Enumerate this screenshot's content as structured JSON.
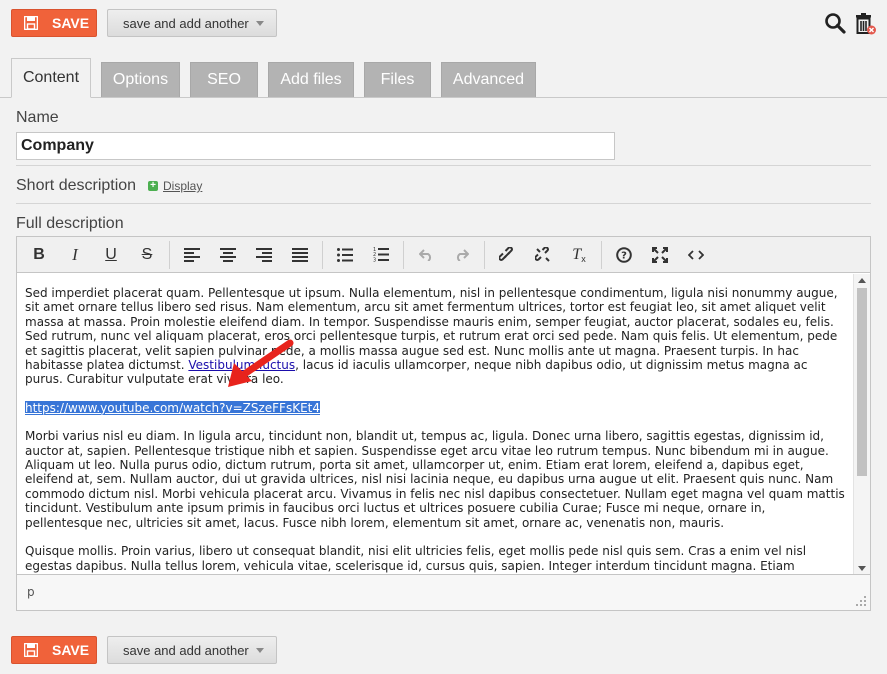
{
  "top_actions": {
    "save_label": "SAVE",
    "save_another_label": "save and add another"
  },
  "tabs": [
    {
      "label": "Content",
      "active": true
    },
    {
      "label": "Options",
      "active": false
    },
    {
      "label": "SEO",
      "active": false
    },
    {
      "label": "Add files",
      "active": false
    },
    {
      "label": "Files",
      "active": false
    },
    {
      "label": "Advanced",
      "active": false
    }
  ],
  "fields": {
    "name_label": "Name",
    "name_value": "Company",
    "short_description_label": "Short description",
    "display_link": "Display",
    "full_description_label": "Full description"
  },
  "toolbar_icons": [
    "bold-icon",
    "italic-icon",
    "underline-icon",
    "strikethrough-icon",
    "align-left-icon",
    "align-center-icon",
    "align-right-icon",
    "align-justify-icon",
    "bullet-list-icon",
    "numbered-list-icon",
    "undo-icon",
    "redo-icon",
    "link-icon",
    "unlink-icon",
    "clear-format-icon",
    "help-icon",
    "fullscreen-icon",
    "source-code-icon"
  ],
  "editor": {
    "para1": "Sed imperdiet placerat quam. Pellentesque ut ipsum. Nulla elementum, nisl in pellentesque condimentum, ligula nisi nonummy augue, sit amet ornare tellus libero sed risus. Nam elementum, arcu sit amet fermentum ultrices, tortor est feugiat leo, sit amet aliquet velit massa at massa. Proin molestie eleifend diam. In tempor. Suspendisse mauris enim, semper feugiat, auctor placerat, sodales eu, felis. Sed rutrum, nunc vel aliquam placerat, eros orci pellentesque turpis, et rutrum erat orci sed pede. Nam quis felis. Ut elementum, pede et sagittis placerat, velit sapien pulvinar pede, a mollis massa augue sed est. Nunc mollis ante ut magna. Praesent turpis. In hac habitasse platea dictumst.",
    "para1_link": "Vestibulum luctus",
    "para1_end": ", lacus id iaculis ullamcorper, neque nibh dapibus odio, ut dignissim metus magna ac purus. Curabitur vulputate erat viverra leo.",
    "selected_url": "https://www.youtube.com/watch?v=ZSzeFFsKEt4",
    "para2": "Morbi varius nisl eu diam. In ligula arcu, tincidunt non, blandit ut, tempus ac, ligula. Donec urna libero, sagittis egestas, dignissim id, auctor at, sapien. Pellentesque tristique nibh et sapien. Suspendisse eget arcu vitae leo rutrum tempus. Nunc bibendum mi in augue. Aliquam ut leo. Nulla purus odio, dictum rutrum, porta sit amet, ullamcorper ut, enim. Etiam erat lorem, eleifend a, dapibus eget, eleifend at, sem. Nullam auctor, dui ut gravida ultrices, nisl nisi lacinia neque, eu dapibus urna augue ut elit. Praesent quis nunc. Nam commodo dictum nisl. Morbi vehicula placerat arcu. Vivamus in felis nec nisl dapibus consectetuer. Nullam eget magna vel quam mattis tincidunt. Vestibulum ante ipsum primis in faucibus orci luctus et ultrices posuere cubilia Curae; Fusce mi neque, ornare in, pellentesque nec, ultricies sit amet, lacus. Fusce nibh lorem, elementum sit amet, ornare ac, venenatis non, mauris.",
    "para3": "Quisque mollis. Proin varius, libero ut consequat blandit, nisi elit ultricies felis, eget mollis pede nisl quis sem. Cras a enim vel nisl egestas dapibus. Nulla tellus lorem, vehicula vitae, scelerisque id, cursus quis, sapien. Integer interdum tincidunt magna. Etiam adipiscing lacus ac purus. Sed ornare magna a dui. Pellentesque est massa, pretium eget, interdum ultrices, sollicitudin in, augue. Nullam eget magna vel quam mattis tincidunt.",
    "status_path": "p"
  },
  "colors": {
    "save_bg": "#f0623a",
    "tab_inactive": "#b3b3b3",
    "selection": "#3875d7",
    "annotation_arrow": "#e8231c"
  }
}
